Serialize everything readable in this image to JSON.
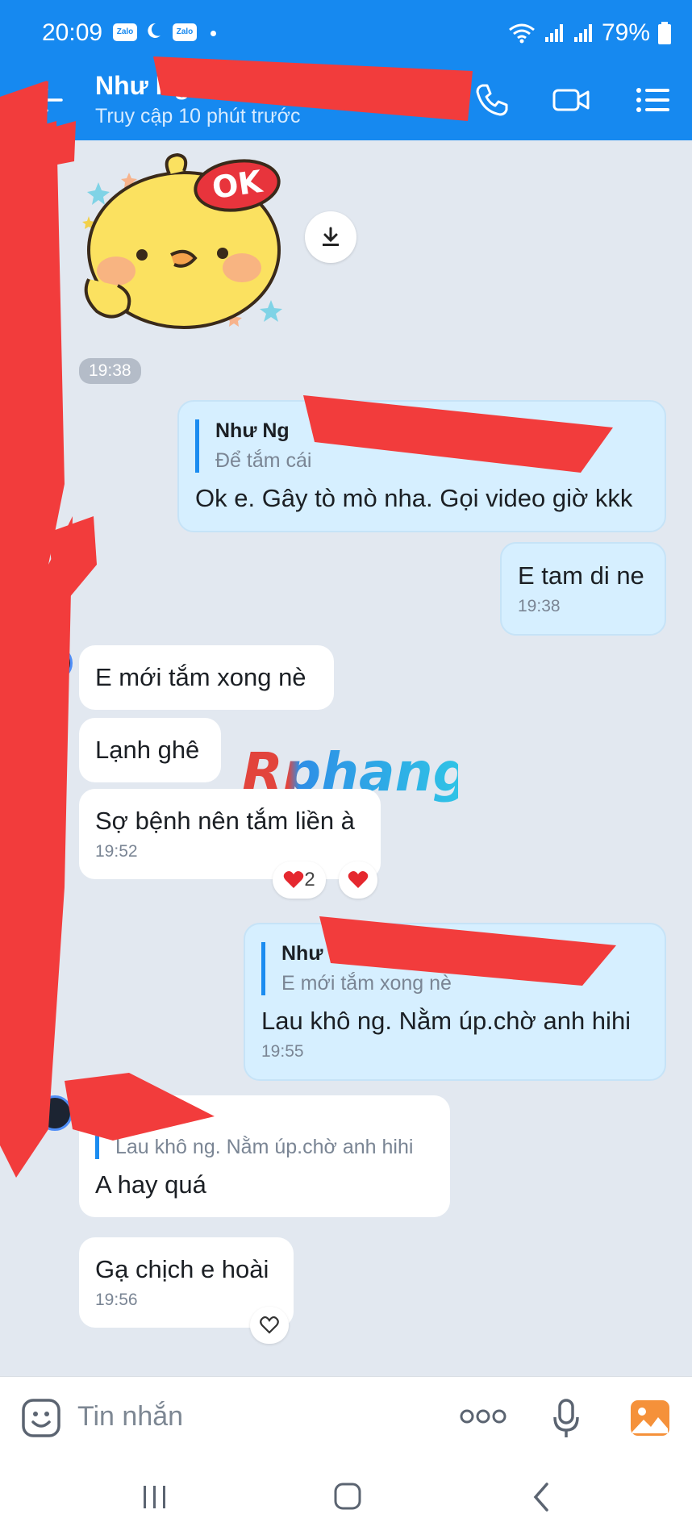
{
  "status_bar": {
    "time": "20:09",
    "zalo_badge": "Zalo",
    "battery": "79%"
  },
  "header": {
    "name": "Như Ng",
    "status": "Truy cập 10 phút trước"
  },
  "sticker": {
    "text": "OK",
    "time": "19:38"
  },
  "messages": [
    {
      "quote_name": "Như Ng",
      "quote_text": "Để tắm cái",
      "text": "Ok e. Gây tò mò nha. Gọi video giờ kkk"
    },
    {
      "text": "E tam di ne",
      "time": "19:38"
    },
    {
      "text": "E mới tắm xong nè"
    },
    {
      "text": "Lạnh ghê"
    },
    {
      "text": "Sợ bệnh nên tắm liền à",
      "time": "19:52",
      "reaction_count": "2"
    },
    {
      "quote_name": "Như Ng",
      "quote_text": "E mới tắm xong nè",
      "text": "Lau khô ng. Nằm úp.chờ anh hihi",
      "time": "19:55"
    },
    {
      "quote_text": "Lau khô ng. Nằm úp.chờ anh hihi",
      "text": "A hay quá"
    },
    {
      "text": "Gạ chịch e hoài",
      "time": "19:56"
    }
  ],
  "watermark": "Rphang",
  "input": {
    "placeholder": "Tin nhắn"
  },
  "colors": {
    "brand": "#1689f0",
    "outgoing_bubble": "#d6efff",
    "background": "#e2e8f0",
    "redaction": "#f23c3c"
  }
}
